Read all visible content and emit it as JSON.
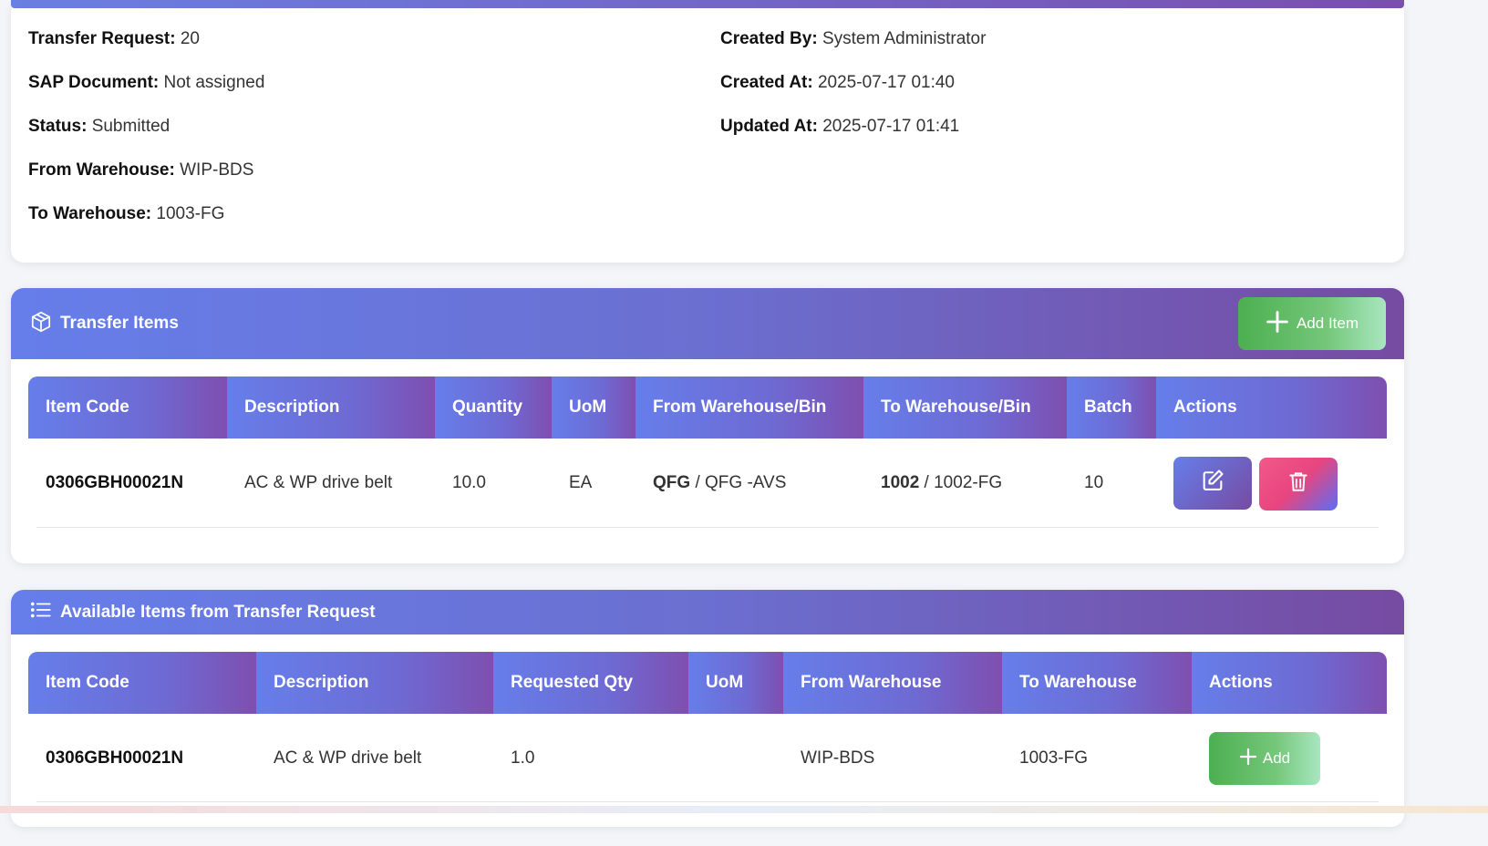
{
  "details": {
    "left": [
      {
        "label": "Transfer Request:",
        "value": "20"
      },
      {
        "label": "SAP Document:",
        "value": "Not assigned"
      },
      {
        "label": "Status:",
        "value": "Submitted"
      },
      {
        "label": "From Warehouse:",
        "value": "WIP-BDS"
      },
      {
        "label": "To Warehouse:",
        "value": "1003-FG"
      }
    ],
    "right": [
      {
        "label": "Created By:",
        "value": "System Administrator"
      },
      {
        "label": "Created At:",
        "value": "2025-07-17 01:40"
      },
      {
        "label": "Updated At:",
        "value": "2025-07-17 01:41"
      }
    ]
  },
  "transfer_items": {
    "title": "Transfer Items",
    "title_icon": "box-icon",
    "add_label": "Add Item",
    "headers": [
      "Item Code",
      "Description",
      "Quantity",
      "UoM",
      "From Warehouse/Bin",
      "To Warehouse/Bin",
      "Batch",
      "Actions"
    ],
    "rows": [
      {
        "item_code": "0306GBH00021N",
        "description": "AC & WP drive belt",
        "quantity": "10.0",
        "uom": "EA",
        "from_wh": "QFG",
        "from_bin": " / QFG -AVS",
        "to_wh": "1002",
        "to_bin": " / 1002-FG",
        "batch": "10"
      }
    ]
  },
  "available_items": {
    "title": "Available Items from Transfer Request",
    "title_icon": "list-icon",
    "headers": [
      "Item Code",
      "Description",
      "Requested Qty",
      "UoM",
      "From Warehouse",
      "To Warehouse",
      "Actions"
    ],
    "rows": [
      {
        "item_code": "0306GBH00021N",
        "description": "AC & WP drive belt",
        "requested_qty": "1.0",
        "uom": "",
        "from_wh": "WIP-BDS",
        "to_wh": "1003-FG",
        "add_label": "Add"
      }
    ]
  },
  "colors": {
    "header_gradient_start": "#667eea",
    "header_gradient_end": "#764ba2",
    "success": "#4caf50",
    "danger": "#e8457e"
  }
}
